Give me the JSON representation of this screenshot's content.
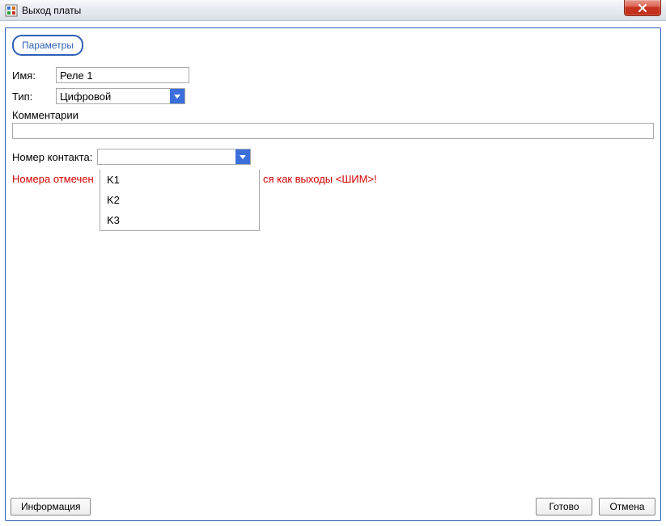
{
  "window": {
    "title": "Выход платы"
  },
  "tabs": {
    "parameters": "Параметры"
  },
  "form": {
    "name_label": "Имя:",
    "name_value": "Реле 1",
    "type_label": "Тип:",
    "type_value": "Цифровой",
    "comments_label": "Комментарии",
    "comments_value": "",
    "contact_label": "Номер контакта:",
    "contact_value": "",
    "contact_options": [
      "K1",
      "K2",
      "K3"
    ],
    "warning_left": "Номера отмечен",
    "warning_right": "ся как выходы <ШИМ>!"
  },
  "footer": {
    "info": "Информация",
    "ok": "Готово",
    "cancel": "Отмена"
  }
}
